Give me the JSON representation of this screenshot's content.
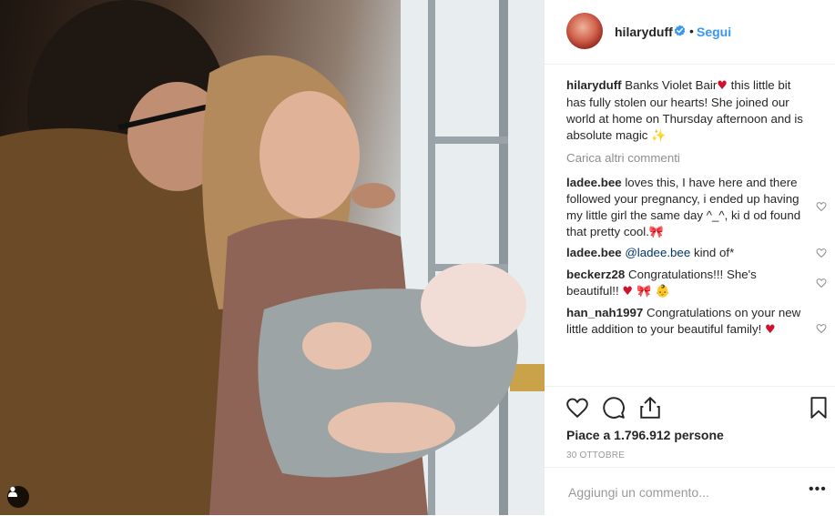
{
  "post": {
    "image_alt": "photo",
    "tag_icon": "person-icon"
  },
  "header": {
    "username": "hilaryduff",
    "separator": "•",
    "follow_label": "Segui"
  },
  "caption": {
    "username": "hilaryduff",
    "text_before": "Banks Violet Bair",
    "text_after": " this little bit has fully stolen our hearts! She joined our world at home on Thursday afternoon and is absolute magic ",
    "emoji_1": "♥",
    "emoji_2": "✨"
  },
  "load_more": "Carica altri commenti",
  "comments": [
    {
      "username": "ladee.bee",
      "text": "loves this, I have here and there followed your pregnancy, i ended up having my little girl the same day ^_^, ki d od found that pretty cool.",
      "emoji": "🎀"
    },
    {
      "username": "ladee.bee",
      "mention": "@ladee.bee",
      "text": "kind of*"
    },
    {
      "username": "beckerz28",
      "text": "Congratulations!!! She's beautiful!!",
      "emoji": "♥ 🎀 👶"
    },
    {
      "username": "han_nah1997",
      "text": "Congratulations on your new little addition to your beautiful family!",
      "emoji": "♥"
    }
  ],
  "likes_text": "Piace a 1.796.912 persone",
  "date": "30 OTTOBRE",
  "comment_input": {
    "placeholder": "Aggiungi un commento..."
  },
  "more_options": "•••",
  "colors": {
    "link": "#3897f0",
    "text": "#262626",
    "muted": "#8e8e8e",
    "heart": "#d0112b"
  }
}
